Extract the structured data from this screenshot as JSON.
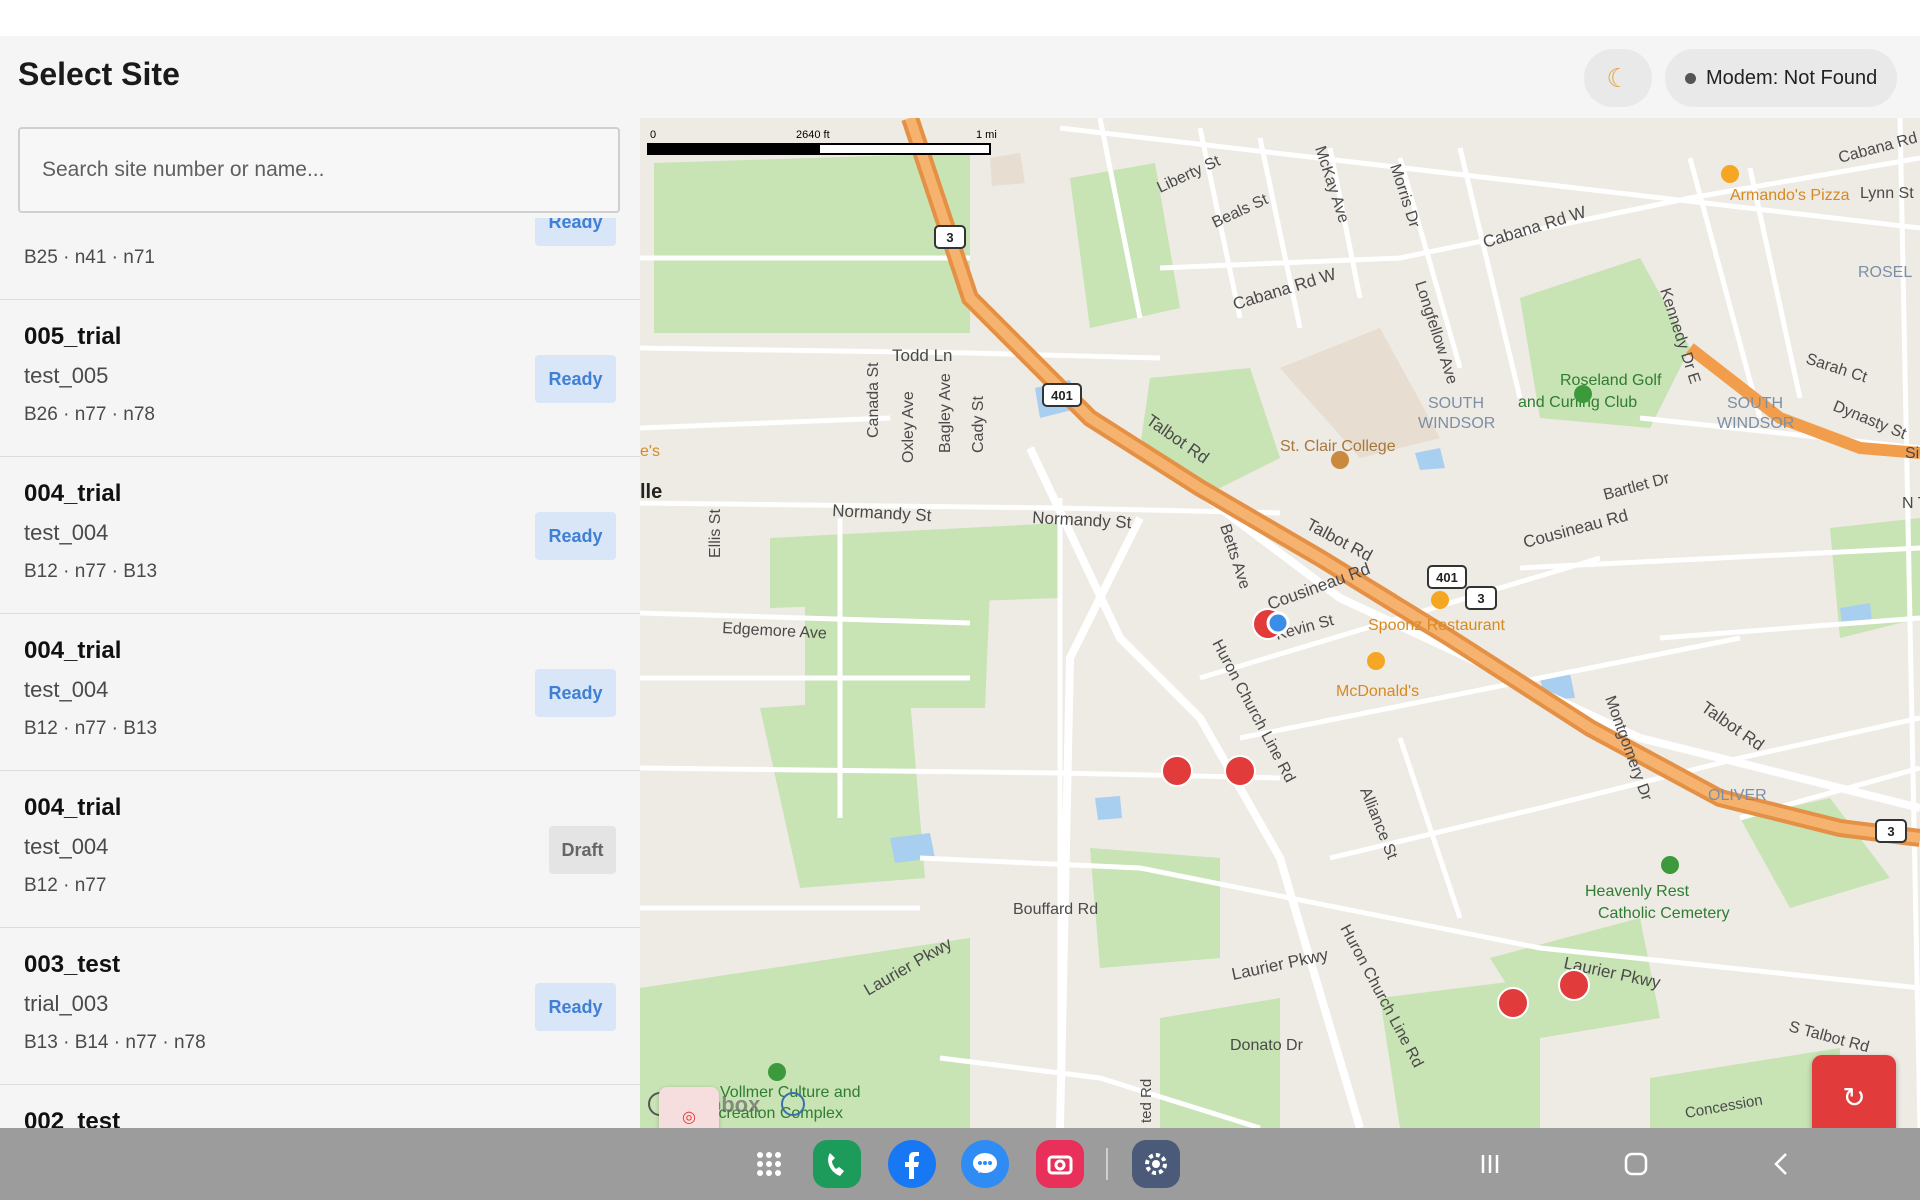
{
  "header": {
    "title": "Select Site",
    "theme_icon": "moon-icon",
    "modem_status": "Modem: Not Found"
  },
  "search": {
    "placeholder": "Search site number or name..."
  },
  "sites": [
    {
      "name": "",
      "sub": "",
      "meta": "B25 · n41 · n71",
      "status": "Ready"
    },
    {
      "name": "005_trial",
      "sub": "test_005",
      "meta": "B26 · n77 · n78",
      "status": "Ready"
    },
    {
      "name": "004_trial",
      "sub": "test_004",
      "meta": "B12 · n77 · B13",
      "status": "Ready"
    },
    {
      "name": "004_trial",
      "sub": "test_004",
      "meta": "B12 · n77 · B13",
      "status": "Ready"
    },
    {
      "name": "004_trial",
      "sub": "test_004",
      "meta": "B12 · n77",
      "status": "Draft"
    },
    {
      "name": "003_test",
      "sub": "trial_003",
      "meta": "B13 · B14 · n77 · n78",
      "status": "Ready"
    },
    {
      "name": "002_test",
      "sub": "",
      "meta": "",
      "status": ""
    }
  ],
  "map": {
    "scale_labels": [
      "0",
      "2640 ft",
      "1 mi"
    ],
    "attribution": "mapbox",
    "labels": {
      "liberty": "Liberty St",
      "beals": "Beals St",
      "mckay": "McKay Ave",
      "morris": "Morris Dr",
      "cabana1": "Cabana Rd W",
      "cabana2": "Cabana Rd W",
      "cabana3": "Cabana Rd",
      "lynn": "Lynn St",
      "rosel": "ROSEL",
      "armando": "Armando's Pizza",
      "longfellow": "Longfellow Ave",
      "kennedy": "Kennedy Dr E",
      "sarah": "Sarah Ct",
      "dynasty": "Dynasty St",
      "roseland": "Roseland Golf",
      "roseland2": "and Curling Club",
      "southwindsor1": "SOUTH",
      "southwindsor1b": "WINDSOR",
      "southwindsor2": "SOUTH",
      "southwindsor2b": "WINDSOR",
      "todd": "Todd Ln",
      "canada": "Canada St",
      "oxley": "Oxley Ave",
      "bagley": "Bagley Ave",
      "cady": "Cady St",
      "stclair": "St. Clair College",
      "talbot1": "Talbot Rd",
      "talbot2": "Talbot Rd",
      "talbot3": "Talbot Rd",
      "stalbot": "S Talbot Rd",
      "bartlet": "Bartlet Dr",
      "cousineau1": "Cousineau Rd",
      "cousineau2": "Cousineau Rd",
      "normandy1": "Normandy St",
      "normandy2": "Normandy St",
      "ellis": "Ellis St",
      "betts": "Betts Ave",
      "kevin": "Kevin St",
      "spoonz": "Spoonz Restaurant",
      "mcdonalds": "McDonald's",
      "edgemore": "Edgemore Ave",
      "huron1": "Huron Church Line Rd",
      "huron2": "Huron Church Line Rd",
      "montgomery": "Montgomery Dr",
      "oliver": "OLIVER",
      "alliance": "Alliance St",
      "heavenly1": "Heavenly Rest",
      "heavenly2": "Catholic Cemetery",
      "bouffard": "Bouffard Rd",
      "laurier1": "Laurier Pkwy",
      "laurier2": "Laurier Pkwy",
      "laurier3": "Laurier Pkwy",
      "donato": "Donato Dr",
      "vollmer1": "Vollmer Culture and",
      "vollmer2": "Recreation Complex",
      "concession": "Concession",
      "lle": "lle",
      "es": "e's",
      "ted": "ted Rd",
      "n": "N T",
      "si": "Si",
      "hw401a": "401",
      "hw401b": "401",
      "hw3a": "3",
      "hw3b": "3",
      "hw3c": "3"
    }
  },
  "navbar": {
    "apps": [
      "apps-grid-icon",
      "phone-icon",
      "facebook-icon",
      "messenger-icon",
      "camera-icon",
      "settings-icon"
    ],
    "system": [
      "recents-icon",
      "home-icon",
      "back-icon"
    ]
  },
  "colors": {
    "accent_red": "#e23b3b",
    "ready_bg": "#d9e6f8",
    "ready_text": "#3f7fd4",
    "highway": "#f29d4b",
    "park": "#c8e3b4"
  }
}
